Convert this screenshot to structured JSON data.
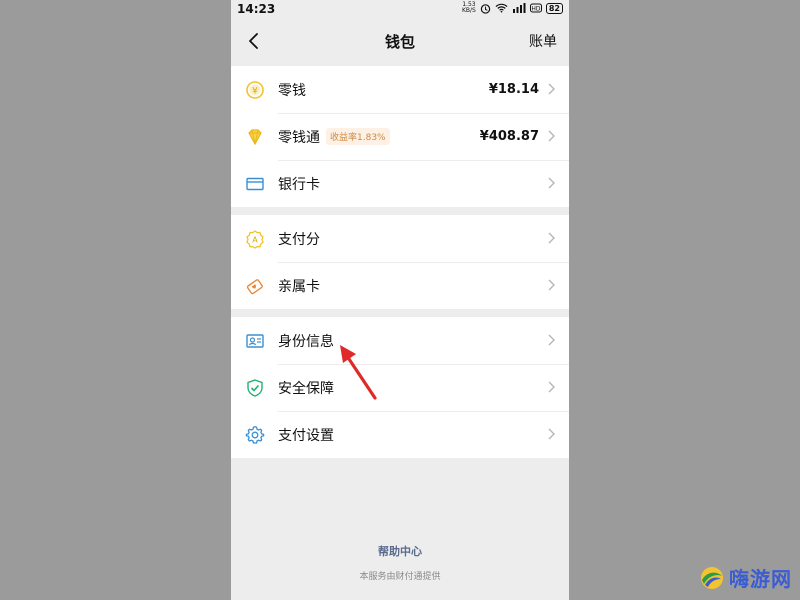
{
  "statusbar": {
    "time": "14:23",
    "net_speed": "1.53",
    "net_unit": "KB/S",
    "battery": "82"
  },
  "navbar": {
    "title": "钱包",
    "right_label": "账单"
  },
  "groups": [
    {
      "items": [
        {
          "label": "零钱",
          "value": "¥18.14",
          "icon": "coin-icon"
        },
        {
          "label": "零钱通",
          "badge": "收益率1.83%",
          "value": "¥408.87",
          "icon": "diamond-icon"
        },
        {
          "label": "银行卡",
          "icon": "card-icon"
        }
      ]
    },
    {
      "items": [
        {
          "label": "支付分",
          "icon": "badge-score-icon"
        },
        {
          "label": "亲属卡",
          "icon": "family-card-icon"
        }
      ]
    },
    {
      "items": [
        {
          "label": "身份信息",
          "icon": "id-card-icon"
        },
        {
          "label": "安全保障",
          "icon": "shield-icon"
        },
        {
          "label": "支付设置",
          "icon": "gear-icon"
        }
      ]
    }
  ],
  "footer": {
    "help": "帮助中心",
    "provider": "本服务由财付通提供"
  },
  "watermark": {
    "text": "嗨游网"
  },
  "colors": {
    "yellow": "#f2c230",
    "orange": "#eb8a3a",
    "blue": "#3a8fd4",
    "green": "#1fb270",
    "arrow": "#e02a2a"
  }
}
